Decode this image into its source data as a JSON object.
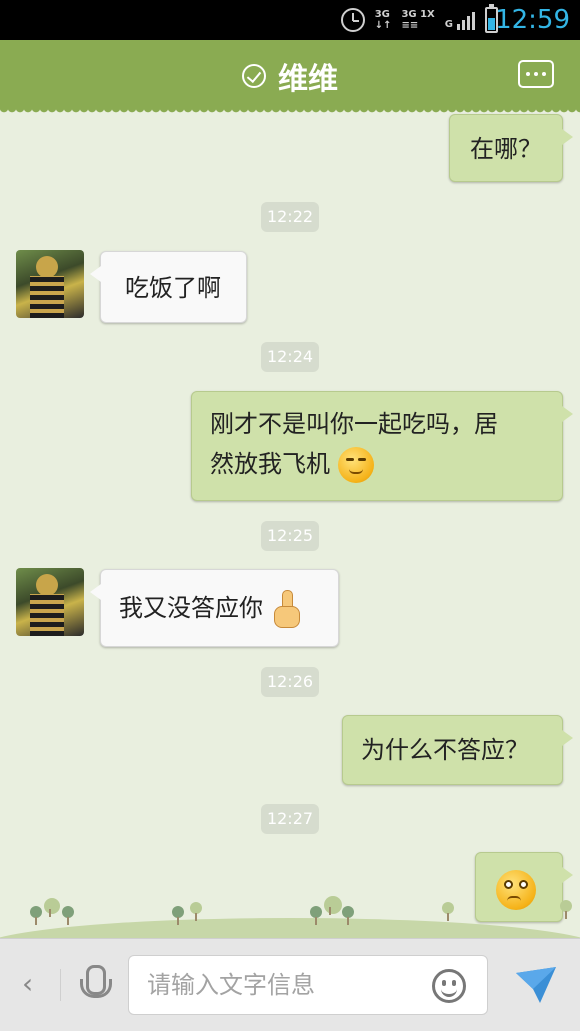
{
  "status_bar": {
    "time": "12:59",
    "network_left": "3G\n↓↑",
    "network_right": "3G 1X\n≡≡",
    "signal_label": "G",
    "accent_color": "#33b5e5"
  },
  "header": {
    "title": "维维",
    "status_icon": "check-circle-icon",
    "more_icon": "more-dots-icon",
    "bar_color": "#8aab52"
  },
  "messages": [
    {
      "from": "me",
      "text": "在哪？"
    },
    {
      "time": "12:22"
    },
    {
      "from": "them",
      "text": "吃饭了啊"
    },
    {
      "time": "12:24"
    },
    {
      "from": "me",
      "text_line1": "刚才不是叫你一起吃吗，居",
      "text_line2": "然放我飞机",
      "emoji": "smirk-face-icon"
    },
    {
      "time": "12:25"
    },
    {
      "from": "them",
      "text": "我又没答应你",
      "emoji": "finger-up-icon"
    },
    {
      "time": "12:26"
    },
    {
      "from": "me",
      "text": "为什么不答应？"
    },
    {
      "time": "12:27"
    },
    {
      "from": "me",
      "emoji": "worried-face-icon"
    }
  ],
  "input_bar": {
    "back_label": "‹",
    "placeholder": "请输入文字信息",
    "mic_icon": "microphone-icon",
    "emoji_icon": "smiley-icon",
    "send_icon": "send-arrow-icon"
  }
}
